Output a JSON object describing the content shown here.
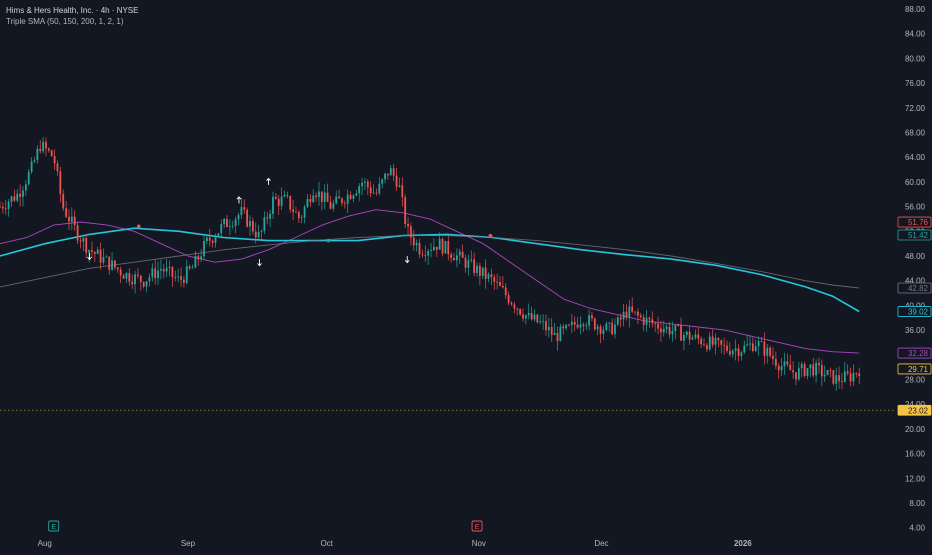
{
  "header": {
    "symbol_title": "Hims & Hers Health, Inc. · 4h · NYSE",
    "indicator_title": "Triple SMA (50, 150, 200, 1, 2, 1)"
  },
  "colors": {
    "background": "#131722",
    "up": "#26a69a",
    "down": "#ef5350",
    "sma50": "#ab47bc",
    "sma150": "#26c6da",
    "sma200": "#787b86",
    "dotted_level": "#f5c542",
    "marker_earnings_green": "#26a69a",
    "marker_earnings_red": "#ef5350"
  },
  "chart_data": {
    "type": "candlestick",
    "title": "Hims & Hers Health, Inc. · 4h · NYSE",
    "y_axis": {
      "range": [
        4,
        88
      ],
      "ticks": [
        "88.00",
        "84.00",
        "80.00",
        "76.00",
        "72.00",
        "68.00",
        "64.00",
        "60.00",
        "56.00",
        "52.00",
        "48.00",
        "44.00",
        "40.00",
        "36.00",
        "32.00",
        "28.00",
        "24.00",
        "20.00",
        "16.00",
        "12.00",
        "8.00",
        "4.00"
      ],
      "position": "right"
    },
    "x_axis": {
      "labels": [
        {
          "text": "Aug",
          "t": 0.05
        },
        {
          "text": "Sep",
          "t": 0.21
        },
        {
          "text": "Oct",
          "t": 0.365
        },
        {
          "text": "Nov",
          "t": 0.535
        },
        {
          "text": "Dec",
          "t": 0.672
        },
        {
          "text": "2026",
          "t": 0.83
        }
      ]
    },
    "price_path": [
      [
        0.0,
        56
      ],
      [
        0.02,
        58
      ],
      [
        0.035,
        62
      ],
      [
        0.045,
        66
      ],
      [
        0.06,
        64
      ],
      [
        0.07,
        56
      ],
      [
        0.085,
        52
      ],
      [
        0.1,
        49
      ],
      [
        0.12,
        47
      ],
      [
        0.14,
        45
      ],
      [
        0.16,
        44
      ],
      [
        0.18,
        46
      ],
      [
        0.2,
        44
      ],
      [
        0.215,
        46
      ],
      [
        0.23,
        50
      ],
      [
        0.25,
        53
      ],
      [
        0.27,
        55
      ],
      [
        0.29,
        51
      ],
      [
        0.305,
        57
      ],
      [
        0.32,
        57
      ],
      [
        0.335,
        54
      ],
      [
        0.35,
        59
      ],
      [
        0.37,
        56
      ],
      [
        0.39,
        58
      ],
      [
        0.405,
        60
      ],
      [
        0.42,
        58
      ],
      [
        0.435,
        62
      ],
      [
        0.445,
        60
      ],
      [
        0.455,
        52
      ],
      [
        0.47,
        49
      ],
      [
        0.49,
        50
      ],
      [
        0.51,
        48
      ],
      [
        0.53,
        46
      ],
      [
        0.55,
        44
      ],
      [
        0.57,
        41
      ],
      [
        0.59,
        38
      ],
      [
        0.605,
        37
      ],
      [
        0.62,
        35
      ],
      [
        0.635,
        36
      ],
      [
        0.65,
        38
      ],
      [
        0.665,
        37
      ],
      [
        0.68,
        36
      ],
      [
        0.69,
        37
      ],
      [
        0.7,
        39
      ],
      [
        0.715,
        38
      ],
      [
        0.73,
        37
      ],
      [
        0.75,
        36
      ],
      [
        0.77,
        35
      ],
      [
        0.79,
        34
      ],
      [
        0.81,
        33
      ],
      [
        0.83,
        33
      ],
      [
        0.845,
        34
      ],
      [
        0.86,
        32
      ],
      [
        0.875,
        30
      ],
      [
        0.89,
        29
      ],
      [
        0.905,
        30
      ],
      [
        0.92,
        29
      ],
      [
        0.935,
        28
      ],
      [
        0.95,
        28.5
      ],
      [
        0.96,
        29.71
      ]
    ],
    "series": [
      {
        "name": "SMA 50",
        "color": "#ab47bc",
        "values": [
          [
            0.0,
            50
          ],
          [
            0.03,
            51
          ],
          [
            0.06,
            53
          ],
          [
            0.09,
            53.5
          ],
          [
            0.12,
            53
          ],
          [
            0.15,
            52
          ],
          [
            0.18,
            50
          ],
          [
            0.21,
            48
          ],
          [
            0.24,
            47
          ],
          [
            0.27,
            47.5
          ],
          [
            0.3,
            49
          ],
          [
            0.33,
            51
          ],
          [
            0.36,
            53
          ],
          [
            0.39,
            54.5
          ],
          [
            0.42,
            55.5
          ],
          [
            0.45,
            55
          ],
          [
            0.48,
            54
          ],
          [
            0.51,
            52
          ],
          [
            0.54,
            50
          ],
          [
            0.57,
            47
          ],
          [
            0.6,
            44
          ],
          [
            0.63,
            41
          ],
          [
            0.66,
            39.5
          ],
          [
            0.69,
            38.5
          ],
          [
            0.72,
            37.5
          ],
          [
            0.75,
            37
          ],
          [
            0.78,
            36.5
          ],
          [
            0.81,
            36
          ],
          [
            0.84,
            35
          ],
          [
            0.87,
            34
          ],
          [
            0.9,
            33
          ],
          [
            0.93,
            32.5
          ],
          [
            0.96,
            32.28
          ]
        ]
      },
      {
        "name": "SMA 150",
        "color": "#26c6da",
        "values": [
          [
            0.0,
            48
          ],
          [
            0.05,
            50
          ],
          [
            0.1,
            51.5
          ],
          [
            0.15,
            52.5
          ],
          [
            0.2,
            52
          ],
          [
            0.25,
            51
          ],
          [
            0.3,
            50.5
          ],
          [
            0.35,
            50.5
          ],
          [
            0.4,
            50.5
          ],
          [
            0.45,
            51.3
          ],
          [
            0.5,
            51.5
          ],
          [
            0.55,
            51
          ],
          [
            0.6,
            50
          ],
          [
            0.65,
            49
          ],
          [
            0.7,
            48.2
          ],
          [
            0.75,
            47.5
          ],
          [
            0.8,
            46.5
          ],
          [
            0.85,
            45
          ],
          [
            0.9,
            43
          ],
          [
            0.93,
            41.5
          ],
          [
            0.96,
            39.02
          ]
        ]
      },
      {
        "name": "SMA 200",
        "color": "#787b86",
        "values": [
          [
            0.0,
            43
          ],
          [
            0.05,
            44.5
          ],
          [
            0.1,
            46
          ],
          [
            0.15,
            47
          ],
          [
            0.2,
            48
          ],
          [
            0.25,
            49
          ],
          [
            0.3,
            49.8
          ],
          [
            0.35,
            50.5
          ],
          [
            0.4,
            51
          ],
          [
            0.45,
            51.3
          ],
          [
            0.5,
            51.3
          ],
          [
            0.55,
            51
          ],
          [
            0.6,
            50.5
          ],
          [
            0.65,
            49.8
          ],
          [
            0.7,
            49
          ],
          [
            0.75,
            48
          ],
          [
            0.8,
            46.8
          ],
          [
            0.85,
            45.5
          ],
          [
            0.9,
            44
          ],
          [
            0.93,
            43.3
          ],
          [
            0.96,
            42.82
          ]
        ]
      }
    ],
    "price_labels": [
      {
        "text": "51.76",
        "value": 53.5,
        "border": "#ef5350",
        "fill": "#131722",
        "color": "#ef5350"
      },
      {
        "text": "51.42",
        "value": 51.4,
        "border": "#26a69a",
        "fill": "#131722",
        "color": "#26a69a"
      },
      {
        "text": "42.82",
        "value": 42.82,
        "border": "#787b86",
        "fill": "#131722",
        "color": "#787b86"
      },
      {
        "text": "39.02",
        "value": 39.02,
        "border": "#26c6da",
        "fill": "#131722",
        "color": "#26c6da"
      },
      {
        "text": "32.28",
        "value": 32.28,
        "border": "#ab47bc",
        "fill": "#131722",
        "color": "#ab47bc"
      },
      {
        "text": "29.71",
        "value": 29.71,
        "border": "#f5c542",
        "fill": "#131722",
        "color": "#f5c542"
      },
      {
        "text": "23.02",
        "value": 23.02,
        "border": "#f5c542",
        "fill": "#f5c542",
        "color": "#131722"
      }
    ],
    "dotted_level": 23.02,
    "arrows": [
      {
        "dir": "down",
        "t": 0.1,
        "value": 48
      },
      {
        "dir": "up",
        "t": 0.267,
        "value": 57
      },
      {
        "dir": "down",
        "t": 0.29,
        "value": 47
      },
      {
        "dir": "up",
        "t": 0.3,
        "value": 60
      },
      {
        "dir": "down",
        "t": 0.455,
        "value": 47.5
      }
    ],
    "cross_dots": [
      {
        "t": 0.155,
        "value": 52.8,
        "color": "#ef5350"
      },
      {
        "t": 0.367,
        "value": 50.5,
        "color": "#26a69a"
      },
      {
        "t": 0.548,
        "value": 51.3,
        "color": "#ef5350"
      }
    ],
    "earnings_markers": [
      {
        "label": "E",
        "t": 0.06,
        "color": "#26a69a"
      },
      {
        "label": "E",
        "t": 0.533,
        "color": "#ef5350"
      }
    ]
  }
}
